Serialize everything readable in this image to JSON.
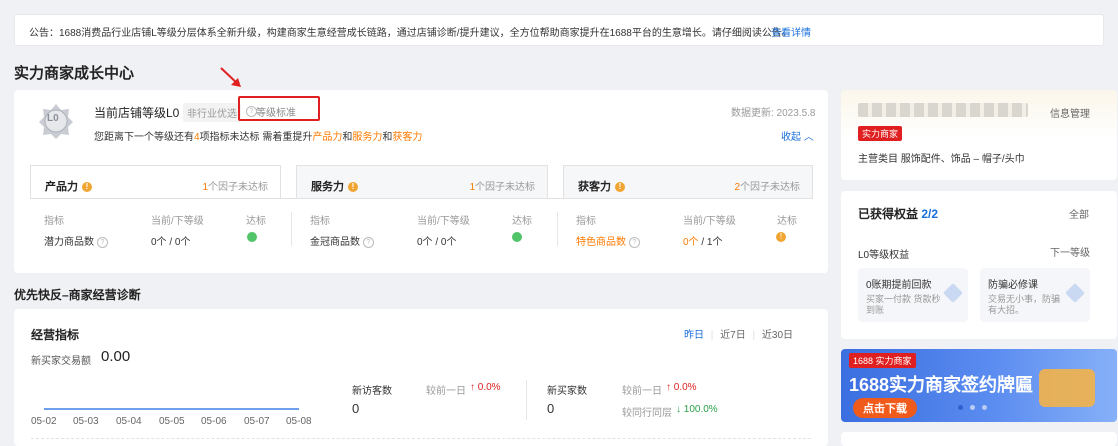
{
  "notice": {
    "text": "公告：1688消费品行业店铺L等级分层体系全新升级，构建商家生意经营成长链路，通过店铺诊断/提升建议，全方位帮助商家提升在1688平台的生意增长。请仔细阅读公告。",
    "link": "查看详情"
  },
  "growth": {
    "title": "实力商家成长中心",
    "level_label": "当前店铺等级L0",
    "industry_tag": "非行业优选",
    "level_std": "等级标准",
    "update": "数据更新: 2023.5.8",
    "desc_prefix": "您距离下一个等级还有",
    "desc_count": "4",
    "desc_mid": "项指标未达标 需着重提升",
    "desc_p1": "产品力",
    "desc_and1": "和",
    "desc_p2": "服务力",
    "desc_and2": "和",
    "desc_p3": "获客力",
    "collapse": "收起",
    "badge_text": "L0"
  },
  "tabs": [
    {
      "name": "产品力",
      "count": "1",
      "info": "个因子未达标"
    },
    {
      "name": "服务力",
      "count": "1",
      "info": "个因子未达标"
    },
    {
      "name": "获客力",
      "count": "2",
      "info": "个因子未达标"
    }
  ],
  "metrics_headers": {
    "col1": "指标",
    "col2": "当前/下等级",
    "col3": "达标"
  },
  "metrics": [
    {
      "name": "潜力商品数",
      "value": "0个 / 0个"
    },
    {
      "name": "金冠商品数",
      "value": "0个 / 0个"
    },
    {
      "name": "特色商品数",
      "value_cur": "0个",
      "value_next": " / 1个"
    }
  ],
  "diag": {
    "title": "优先快反–商家经营诊断",
    "ops_title": "经营指标",
    "ranges": [
      "昨日",
      "近7日",
      "近30日"
    ],
    "gmv_label": "新买家交易额",
    "gmv_value": "0.00",
    "x_labels": [
      "05-02",
      "05-03",
      "05-04",
      "05-05",
      "05-06",
      "05-07",
      "05-08"
    ],
    "visitors_label": "新访客数",
    "visitors_value": "0",
    "visitors_cmp": "较前一日",
    "visitors_delta": "↑ 0.0%",
    "buyers_label": "新买家数",
    "buyers_value": "0",
    "buyers_cmp": "较前一日",
    "buyers_delta": "↑ 0.0%",
    "buyers_cmp2": "较同行同层",
    "buyers_delta2": "↓ 100.0%"
  },
  "shop": {
    "name": "[name blurred]",
    "info_mgmt": "信息管理",
    "tag": "实力商家",
    "category": "主营类目  服饰配件、饰品 – 帽子/头巾"
  },
  "benefits": {
    "title": "已获得权益",
    "count": "2/2",
    "all": "全部",
    "level": "L0等级权益",
    "next": "下一等级",
    "items": [
      {
        "title": "0账期提前回款",
        "desc": "买家一付款 货款秒到账"
      },
      {
        "title": "防骗必修课",
        "desc": "交易无小事，防骗有大招。"
      }
    ]
  },
  "banner": {
    "brand": "1688",
    "tag": "实力商家",
    "title": "1688实力商家签约牌匾",
    "cta": "点击下载"
  },
  "colors": {
    "accent": "#1a6fdc",
    "orange": "#ff7a00",
    "red": "#e02020",
    "green": "#52c46a"
  }
}
